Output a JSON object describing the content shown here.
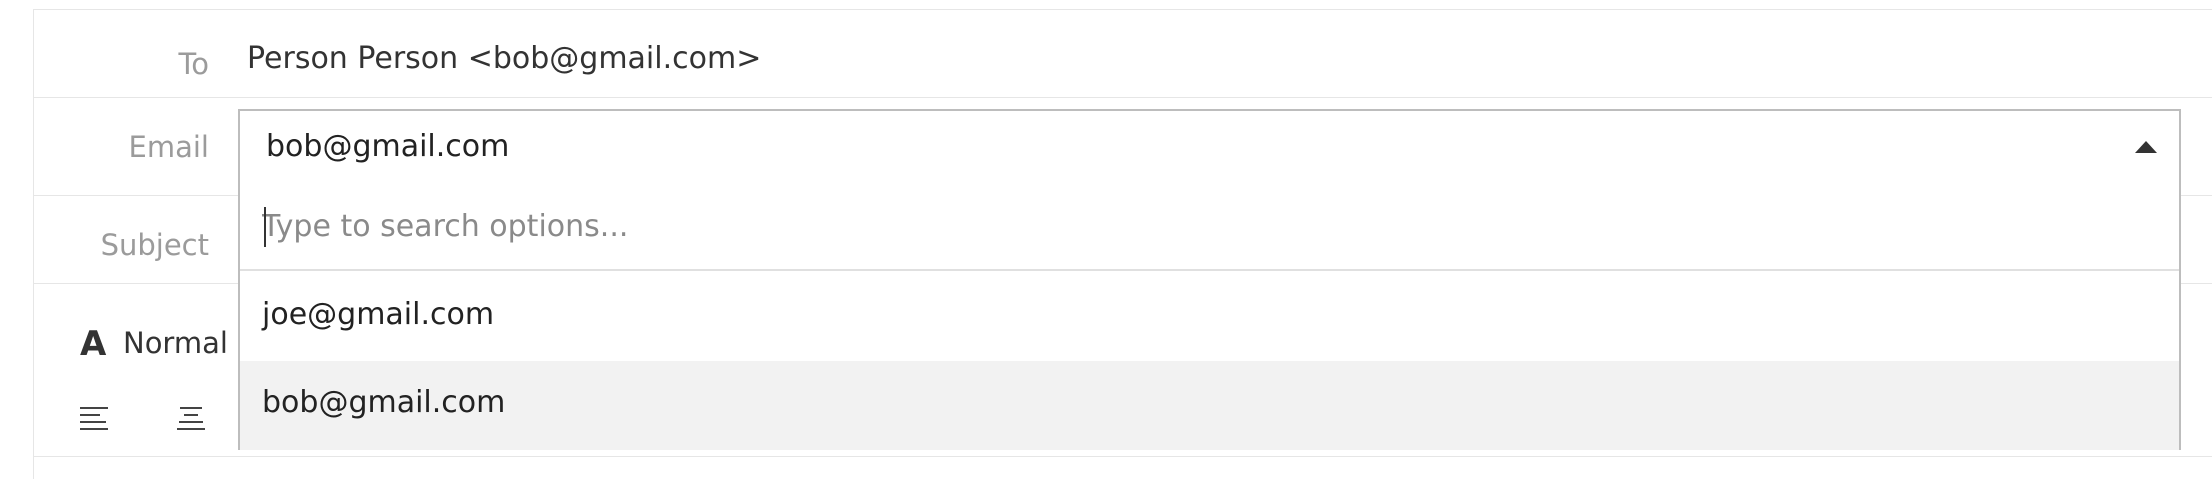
{
  "compose": {
    "to": {
      "label": "To",
      "value": "Person Person <bob@gmail.com>"
    },
    "email": {
      "label": "Email",
      "selected": "bob@gmail.com"
    },
    "subject": {
      "label": "Subject"
    }
  },
  "email_dropdown": {
    "search_placeholder": "Type to search options...",
    "search_value": "",
    "options": [
      {
        "label": "joe@gmail.com",
        "highlighted": false
      },
      {
        "label": "bob@gmail.com",
        "highlighted": true
      }
    ]
  },
  "toolbar": {
    "font_style_icon": "A",
    "font_style_label": "Normal",
    "icons": [
      "align-left-icon",
      "align-center-icon"
    ]
  },
  "colors": {
    "label": "#9b9b9b",
    "border": "#bdbdbd",
    "highlight": "#f2f2f2"
  }
}
